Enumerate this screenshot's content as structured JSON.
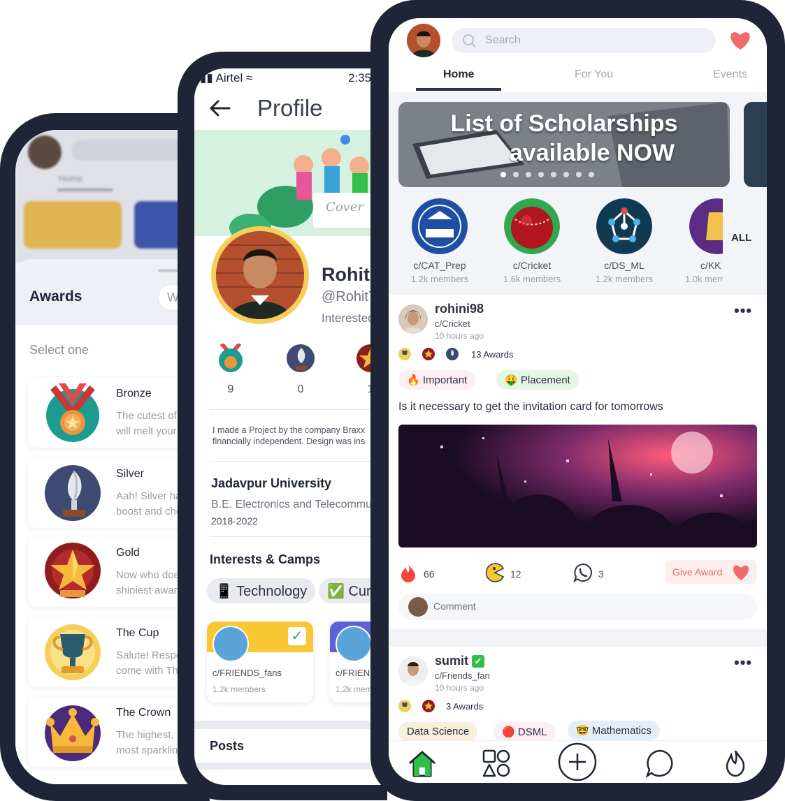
{
  "awards_screen": {
    "title": "Awards",
    "search_placeholder": "W",
    "select_label": "Select one",
    "items": [
      {
        "name": "Bronze",
        "desc": "The cutest of\nwill melt your"
      },
      {
        "name": "Silver",
        "desc": "Aah! Silver ha\nboost and che"
      },
      {
        "name": "Gold",
        "desc": "Now who doe\nshiniest awar"
      },
      {
        "name": "The Cup",
        "desc": "Salute! Respe\ncome with Th"
      },
      {
        "name": "The Crown",
        "desc": "The highest, I\nmost sparklin"
      }
    ]
  },
  "profile_screen": {
    "carrier": "Airtel",
    "time": "2:35",
    "title": "Profile",
    "cover_label": "Cover",
    "name": "Rohit",
    "handle": "@Rohit7",
    "interest_line": "Interested",
    "stats": [
      "9",
      "0",
      "1"
    ],
    "bio_line1": "I made a Project by the company Braxx",
    "bio_line2": "financially independent. Design was ins",
    "university": "Jadavpur University",
    "degree": "B.E. Electronics and Telecommu",
    "years": "2018-2022",
    "interests_title": "Interests & Camps",
    "interests": [
      {
        "icon": "📱",
        "label": "Technology"
      },
      {
        "icon": "✅",
        "label": "Curr"
      }
    ],
    "communities": [
      {
        "name": "c/FRIENDS_fans",
        "members": "1.2k members"
      },
      {
        "name": "c/FRIEN",
        "members": "1.2k mem"
      }
    ],
    "posts_label": "Posts"
  },
  "feed_screen": {
    "search_placeholder": "Search",
    "tabs": [
      "Home",
      "For You",
      "Events"
    ],
    "banner": {
      "line1": "List of Scholarships",
      "line2": "available NOW",
      "active_slide": 1,
      "slide_count": 8
    },
    "channels": [
      {
        "name": "c/CAT_Prep",
        "members": "1.2k members"
      },
      {
        "name": "c/Cricket",
        "members": "1.6k members"
      },
      {
        "name": "c/DS_ML",
        "members": "1.2k members"
      },
      {
        "name": "c/KK",
        "members": "1.0k mem"
      }
    ],
    "all_label": "ALL",
    "post1": {
      "user": "rohini98",
      "community": "c/Cricket",
      "time": "10 hours ago",
      "awards": "13 Awards",
      "tags": [
        {
          "emoji": "🔥",
          "label": "Important"
        },
        {
          "emoji": "🤑",
          "label": "Placement"
        }
      ],
      "text": "Is it necessary to get the invitation card for tomorrows",
      "likes": "66",
      "pacman": "12",
      "comments": "3",
      "give_award": "Give Award",
      "comment_placeholder": "Comment"
    },
    "post2": {
      "user": "sumit",
      "community": "c/Friends_fan",
      "time": "10 hours ago",
      "awards": "3 Awards",
      "tags": [
        {
          "emoji": "",
          "label": "Data Science"
        },
        {
          "emoji": "🔴",
          "label": "DSML"
        },
        {
          "emoji": "🤓",
          "label": "Mathematics"
        }
      ]
    },
    "colors": {
      "accent": "#2b3350",
      "heart": "#f26b6b",
      "home_active": "#2fbf4a",
      "frame": "#1f2536"
    }
  }
}
